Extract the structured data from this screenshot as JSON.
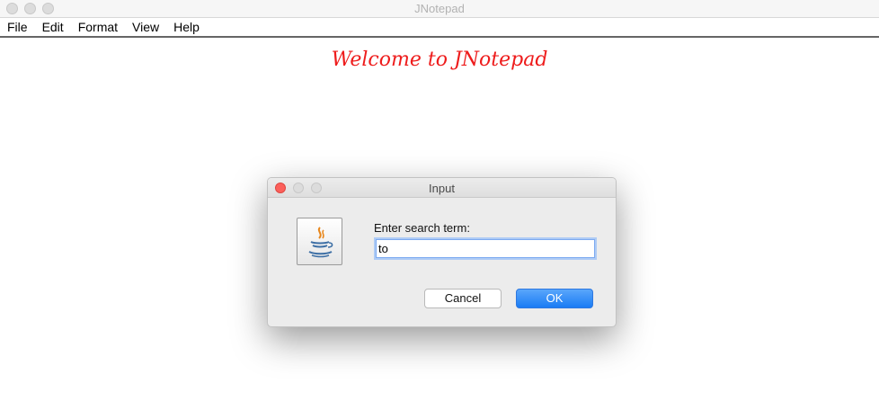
{
  "window": {
    "title": "JNotepad"
  },
  "menu": {
    "items": [
      "File",
      "Edit",
      "Format",
      "View",
      "Help"
    ]
  },
  "editor": {
    "welcome_text": "Welcome to JNotepad"
  },
  "dialog": {
    "title": "Input",
    "prompt": "Enter search term:",
    "input_value": "to",
    "icon": "java-coffee-cup-icon",
    "cancel_label": "Cancel",
    "ok_label": "OK"
  },
  "colors": {
    "welcome_text": "#ee1c1c",
    "ok_button": "#1a7cf4",
    "close_light": "#fc605b"
  }
}
